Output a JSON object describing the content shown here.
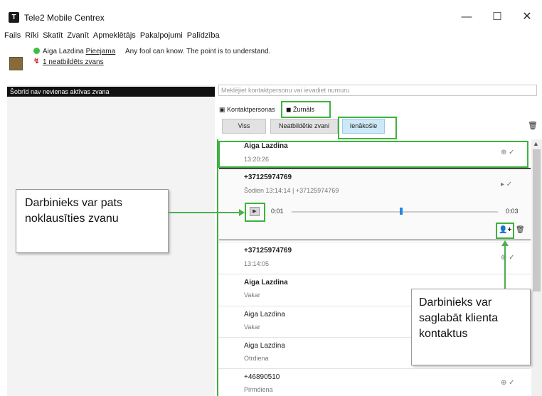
{
  "window": {
    "app_icon": "T",
    "title": "Tele2 Mobile Centrex",
    "minimize": "—",
    "maximize": "☐",
    "close": "✕"
  },
  "menu": [
    "Fails",
    "Rīki",
    "Skatīt",
    "Zvanīt",
    "Apmeklētājs",
    "Pakalpojumi",
    "Palīdzība"
  ],
  "user": {
    "name": "Aiga Lazdina",
    "status": "Pieejama",
    "message": "Any fool can know. The point is to understand.",
    "missed_calls": "1 neatbildēts zvans"
  },
  "left": {
    "active_calls": "Šobrīd nav nevienas aktīvas zvana"
  },
  "right": {
    "search_placeholder": "Meklējiet kontaktpersonu vai ievadiet numuru",
    "tabs": {
      "contacts": "Kontaktpersonas",
      "journal": "Žurnāls"
    },
    "filters": {
      "all": "Viss",
      "missed": "Neatbildētie zvani",
      "incoming": "Ienākošie"
    },
    "entries": [
      {
        "name": "Aiga Lazdina",
        "time": "13:20:26",
        "bold": true
      },
      {
        "name": "+37125974769",
        "time": "Šodien 13:14:14  |  +37125974769",
        "bold": true
      },
      {
        "name": "+37125974769",
        "time": "13:14:05",
        "bold": true
      },
      {
        "name": "Aiga Lazdina",
        "time": "Vakar",
        "bold": true
      },
      {
        "name": "Aiga Lazdina",
        "time": "Vakar",
        "bold": false
      },
      {
        "name": "Aiga Lazdina",
        "time": "Otrdiena",
        "bold": false
      },
      {
        "name": "+46890510",
        "time": "Pirmdiena",
        "bold": false
      }
    ],
    "player": {
      "start": "0:01",
      "end": "0:03",
      "progress": 0.52
    }
  },
  "callouts": {
    "listen": "Darbinieks var pats noklausīties zvanu",
    "save": "Darbinieks var saglabāt klienta kontaktus"
  },
  "colors": {
    "highlight": "#3db33d",
    "accent": "#1e88e5",
    "missed": "#d02020",
    "status_online": "#3fbf3f"
  }
}
